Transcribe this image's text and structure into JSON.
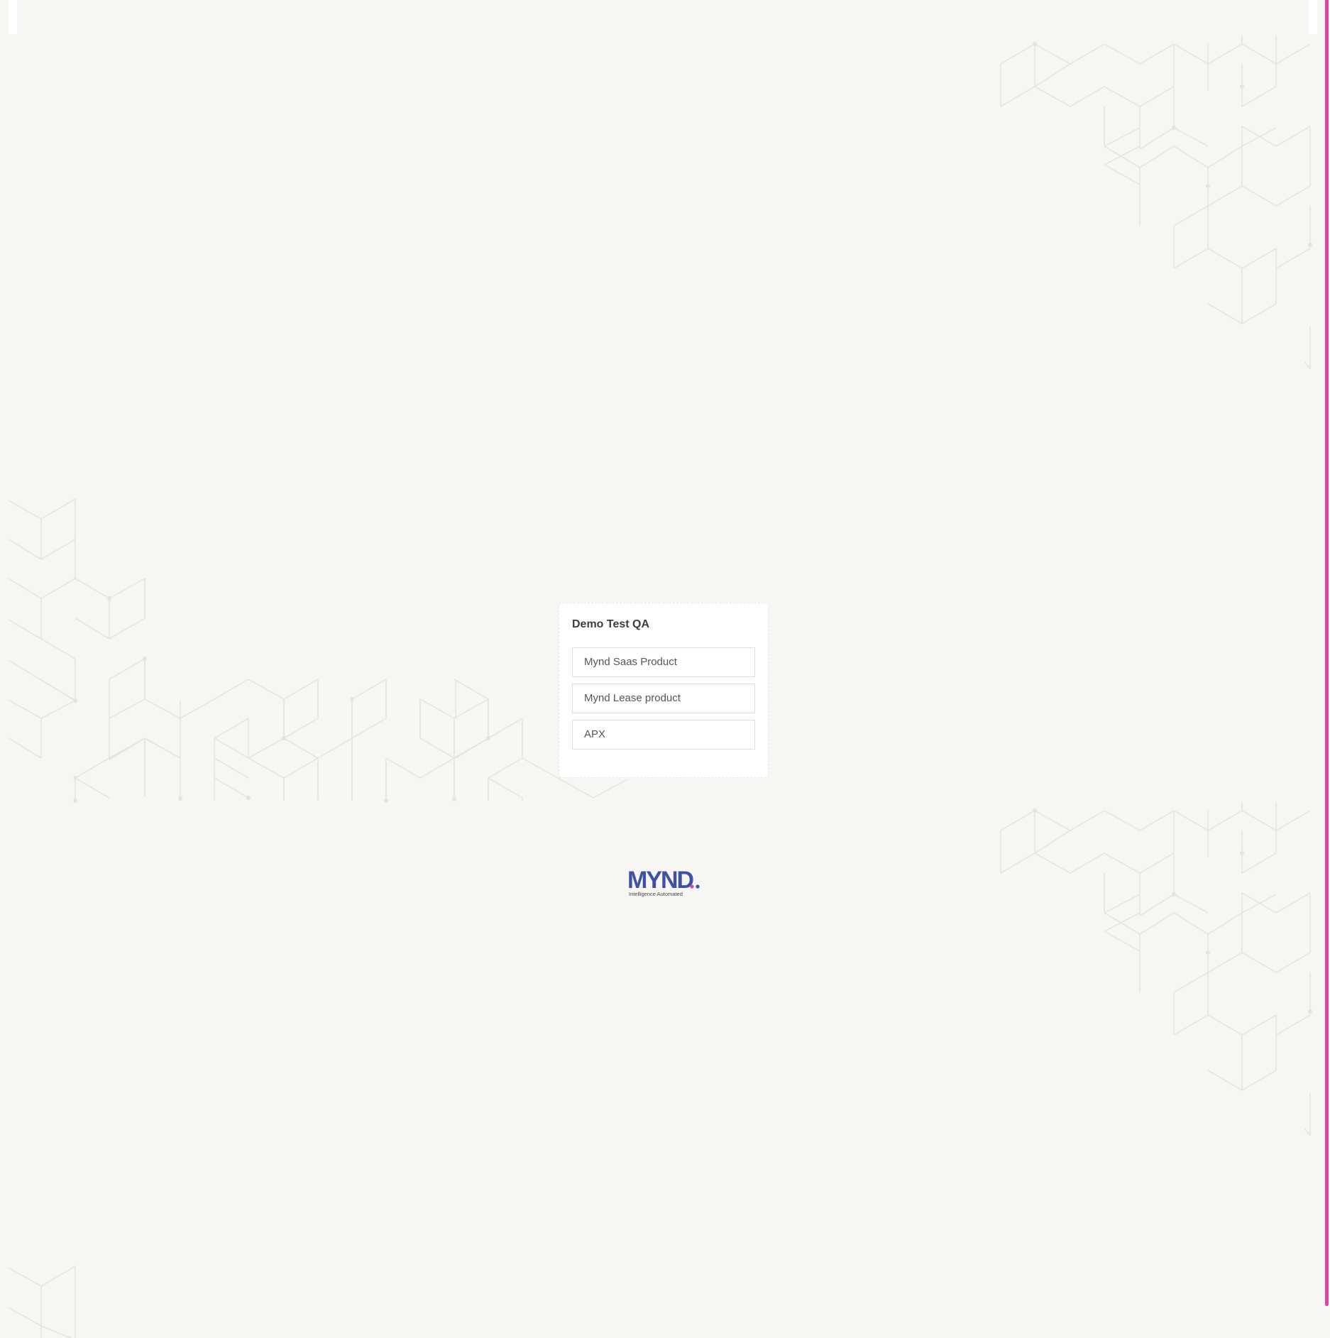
{
  "workspace": {
    "title": "Demo Test QA",
    "products": [
      {
        "label": "Mynd Saas Product"
      },
      {
        "label": "Mynd Lease product"
      },
      {
        "label": "APX"
      }
    ]
  },
  "brand": {
    "logo_text": "MYND",
    "tagline": "Intelligence Automated",
    "primary_color": "#3f51a5",
    "accent_color": "#e5439b"
  }
}
